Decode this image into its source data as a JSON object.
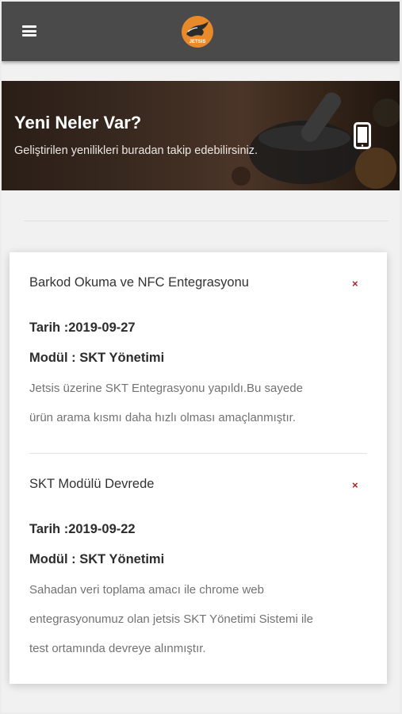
{
  "app": {
    "logo_text": "JETSIS"
  },
  "hero": {
    "title": "Yeni Neler Var?",
    "subtitle": "Geliştirilen yenilikleri buradan takip edebilirsiniz."
  },
  "entries": [
    {
      "title": "Barkod Okuma ve NFC Entegrasyonu",
      "close_label": "×",
      "date_line": "Tarih :2019-09-27",
      "module_line": "Modül : SKT Yönetimi",
      "desc_lines": [
        "Jetsis üzerine SKT Entegrasyonu yapıldı.Bu sayede",
        "ürün arama kısmı daha hızlı olması amaçlanmıştır."
      ]
    },
    {
      "title": "SKT Modülü Devrede",
      "close_label": "×",
      "date_line": "Tarih :2019-09-22",
      "module_line": "Modül : SKT Yönetimi",
      "desc_lines": [
        "Sahadan veri toplama amacı ile chrome web",
        "entegrasyonumuz olan jetsis SKT Yönetimi Sistemi ile",
        "test ortamında devreye alınmıştır."
      ]
    }
  ],
  "colors": {
    "topbar": "#4a4a4a",
    "close_icon": "#b22222",
    "logo_orange": "#e98a2a"
  }
}
